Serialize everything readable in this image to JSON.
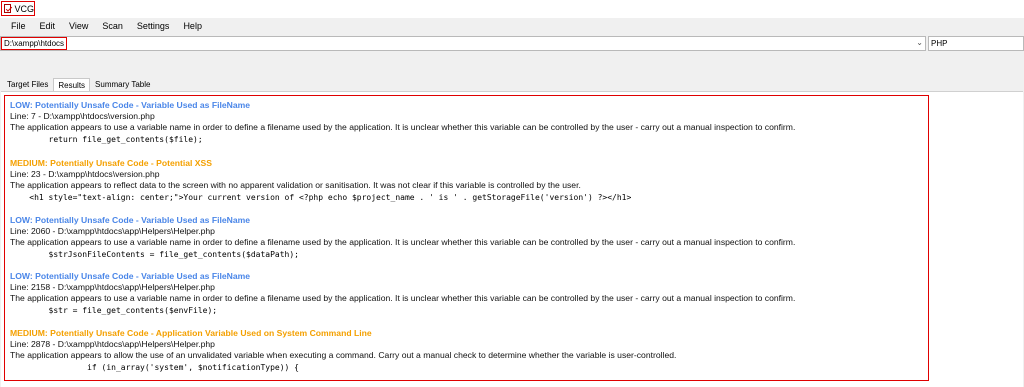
{
  "window": {
    "title": "VCG"
  },
  "menu": {
    "items": [
      "File",
      "Edit",
      "View",
      "Scan",
      "Settings",
      "Help"
    ]
  },
  "path": {
    "value": "D:\\xampp\\htdocs"
  },
  "language": {
    "value": "PHP"
  },
  "tabs": [
    "Target Files",
    "Results",
    "Summary Table"
  ],
  "results": [
    {
      "severity": "low",
      "title": "LOW: Potentially Unsafe Code - Variable Used as FileName",
      "line": "Line: 7 - D:\\xampp\\htdocs\\version.php",
      "desc": "The application appears to use a variable name in order to define a filename used by the application. It is unclear whether this variable can be controlled by the user - carry out a manual inspection to confirm.",
      "code": "        return file_get_contents($file);"
    },
    {
      "severity": "medium",
      "title": "MEDIUM: Potentially Unsafe Code - Potential XSS",
      "line": "Line: 23 - D:\\xampp\\htdocs\\version.php",
      "desc": "The application appears to reflect data to the screen with no apparent validation or sanitisation. It was not clear if this variable is controlled by the user.",
      "code": "    <h1 style=\"text-align: center;\">Your current version of <?php echo $project_name . ' is ' . getStorageFile('version') ?></h1>"
    },
    {
      "severity": "low",
      "title": "LOW: Potentially Unsafe Code - Variable Used as FileName",
      "line": "Line: 2060 - D:\\xampp\\htdocs\\app\\Helpers\\Helper.php",
      "desc": "The application appears to use a variable name in order to define a filename used by the application. It is unclear whether this variable can be controlled by the user - carry out a manual inspection to confirm.",
      "code": "        $strJsonFileContents = file_get_contents($dataPath);"
    },
    {
      "severity": "low",
      "title": "LOW: Potentially Unsafe Code - Variable Used as FileName",
      "line": "Line: 2158 - D:\\xampp\\htdocs\\app\\Helpers\\Helper.php",
      "desc": "The application appears to use a variable name in order to define a filename used by the application. It is unclear whether this variable can be controlled by the user - carry out a manual inspection to confirm.",
      "code": "        $str = file_get_contents($envFile);"
    },
    {
      "severity": "medium",
      "title": "MEDIUM: Potentially Unsafe Code - Application Variable Used on System Command Line",
      "line": "Line: 2878 - D:\\xampp\\htdocs\\app\\Helpers\\Helper.php",
      "desc": "The application appears to allow the use of an unvalidated variable when executing a command. Carry out a manual check to determine whether the variable is user-controlled.",
      "code": "                if (in_array('system', $notificationType)) {"
    }
  ],
  "colors": {
    "low": "#4a86e8",
    "medium": "#f4a000",
    "highlight": "#e00000"
  }
}
